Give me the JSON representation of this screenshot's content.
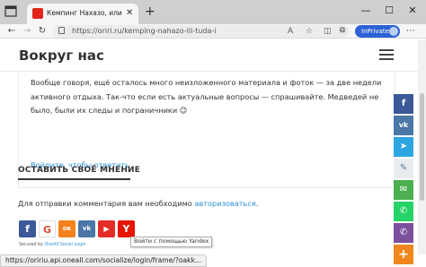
{
  "browser": {
    "tab_title": "Кемпинг Нахазо, или Туда и Отс",
    "tab_close": "✕",
    "new_tab": "+",
    "window_controls": {
      "minimize": "—",
      "maximize": "☐",
      "close": "✕"
    },
    "nav": {
      "back": "←",
      "forward": "→",
      "reload": "↻"
    },
    "url": "https://oriri.ru/kemping-nahazo-ili-tuda-i...",
    "url_parts": {
      "scheme": "https://",
      "rest": "oriri.ru/kemping-nahazo-ili-tuda-i..."
    },
    "toolbar_icons": [
      "a-icon",
      "star-icon",
      "split-screen-icon",
      "favorites-icon",
      "collections-icon"
    ],
    "inprivate_label": "InPrivate",
    "more": "⋯"
  },
  "site": {
    "title": "Вокруг нас"
  },
  "comment": {
    "text": "Вообще говоря, ещё осталось много неизложенного материала и фоток — за две недели активного отдыха. Так-что если есть актуальные вопросы — спрашивайте. Медведей не было, были их следы и пограничники 😉",
    "reply_link": "Войдите, чтобы ответить"
  },
  "leave_comment": {
    "heading": "ОСТАВИТЬ СВОЁ МНЕНИЕ",
    "auth_prefix": "Для отправки комментария вам необходимо ",
    "auth_link": "авторизоваться",
    "auth_suffix": "."
  },
  "social_login": {
    "buttons": [
      {
        "name": "facebook",
        "glyph": "f",
        "color": "#3b5998"
      },
      {
        "name": "google",
        "glyph": "G",
        "color": "#ffffff"
      },
      {
        "name": "odnoklassniki",
        "glyph": "ок",
        "color": "#f4811e"
      },
      {
        "name": "vkontakte",
        "glyph": "vk",
        "color": "#4a76a8"
      },
      {
        "name": "youtube",
        "glyph": "▶",
        "color": "#e52d27"
      },
      {
        "name": "yandex",
        "glyph": "Y",
        "color": "#e61400"
      }
    ],
    "secured_prefix": "Secured by ",
    "secured_brand": "OneAll Social Login",
    "tooltip": "Войти с помощью Yandex"
  },
  "share_bar": [
    {
      "name": "facebook",
      "glyph": "f",
      "color": "#3b5998"
    },
    {
      "name": "vkontakte",
      "glyph": "vk",
      "color": "#4a76a8"
    },
    {
      "name": "telegram",
      "glyph": "➤",
      "color": "#2ca5e0"
    },
    {
      "name": "livejournal",
      "glyph": "✎",
      "color": "#e8ecef"
    },
    {
      "name": "email",
      "glyph": "✉",
      "color": "#4caf50"
    },
    {
      "name": "whatsapp",
      "glyph": "✆",
      "color": "#25d366"
    },
    {
      "name": "viber",
      "glyph": "✆",
      "color": "#7b519d"
    },
    {
      "name": "more",
      "glyph": "+",
      "color": "#f0861e"
    }
  ],
  "status_url": "https://oririu.api.oneall.com/socialize/login/frame/?oakk..."
}
